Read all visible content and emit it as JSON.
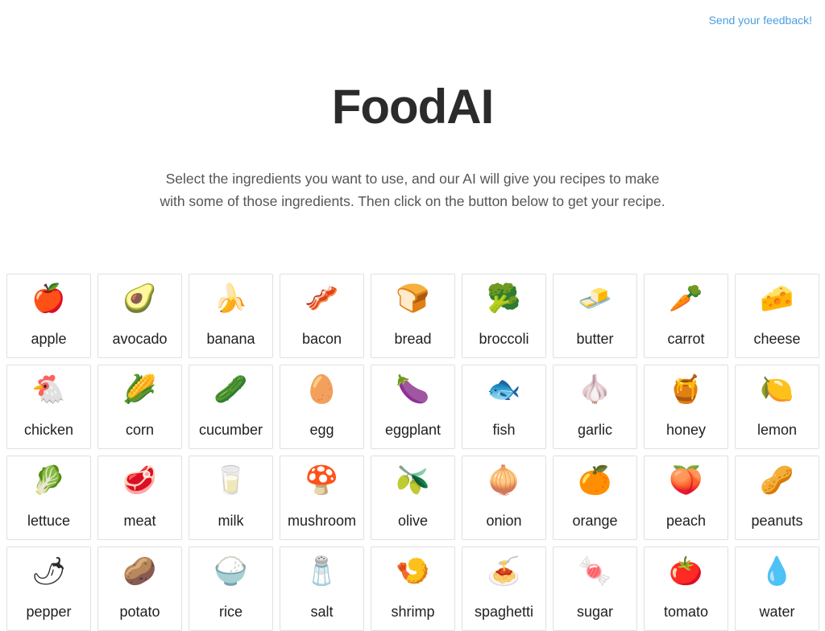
{
  "header": {
    "feedback_link": "Send your feedback!"
  },
  "main": {
    "title": "FoodAI",
    "intro": "Select the ingredients you want to use, and our AI will give you recipes to make with some of those ingredients. Then click on the button below to get your recipe."
  },
  "ingredients": [
    {
      "label": "apple",
      "icon": "🍎",
      "icon_name": "apple-icon"
    },
    {
      "label": "avocado",
      "icon": "🥑",
      "icon_name": "avocado-icon"
    },
    {
      "label": "banana",
      "icon": "🍌",
      "icon_name": "banana-icon"
    },
    {
      "label": "bacon",
      "icon": "🥓",
      "icon_name": "bacon-icon"
    },
    {
      "label": "bread",
      "icon": "🍞",
      "icon_name": "bread-icon"
    },
    {
      "label": "broccoli",
      "icon": "🥦",
      "icon_name": "broccoli-icon"
    },
    {
      "label": "butter",
      "icon": "🧈",
      "icon_name": "butter-icon"
    },
    {
      "label": "carrot",
      "icon": "🥕",
      "icon_name": "carrot-icon"
    },
    {
      "label": "cheese",
      "icon": "🧀",
      "icon_name": "cheese-icon"
    },
    {
      "label": "chicken",
      "icon": "🐔",
      "icon_name": "chicken-icon"
    },
    {
      "label": "corn",
      "icon": "🌽",
      "icon_name": "corn-icon"
    },
    {
      "label": "cucumber",
      "icon": "🥒",
      "icon_name": "cucumber-icon"
    },
    {
      "label": "egg",
      "icon": "🥚",
      "icon_name": "egg-icon"
    },
    {
      "label": "eggplant",
      "icon": "🍆",
      "icon_name": "eggplant-icon"
    },
    {
      "label": "fish",
      "icon": "🐟",
      "icon_name": "fish-icon"
    },
    {
      "label": "garlic",
      "icon": "🧄",
      "icon_name": "garlic-icon"
    },
    {
      "label": "honey",
      "icon": "🍯",
      "icon_name": "honey-icon"
    },
    {
      "label": "lemon",
      "icon": "🍋",
      "icon_name": "lemon-icon"
    },
    {
      "label": "lettuce",
      "icon": "🥬",
      "icon_name": "lettuce-icon"
    },
    {
      "label": "meat",
      "icon": "🥩",
      "icon_name": "meat-icon"
    },
    {
      "label": "milk",
      "icon": "🥛",
      "icon_name": "milk-icon"
    },
    {
      "label": "mushroom",
      "icon": "🍄",
      "icon_name": "mushroom-icon"
    },
    {
      "label": "olive",
      "icon": "🫒",
      "icon_name": "olive-icon"
    },
    {
      "label": "onion",
      "icon": "🧅",
      "icon_name": "onion-icon"
    },
    {
      "label": "orange",
      "icon": "🍊",
      "icon_name": "orange-icon"
    },
    {
      "label": "peach",
      "icon": "🍑",
      "icon_name": "peach-icon"
    },
    {
      "label": "peanuts",
      "icon": "🥜",
      "icon_name": "peanuts-icon"
    },
    {
      "label": "pepper",
      "icon": "🌶",
      "icon_name": "pepper-icon"
    },
    {
      "label": "potato",
      "icon": "🥔",
      "icon_name": "potato-icon"
    },
    {
      "label": "rice",
      "icon": "🍚",
      "icon_name": "rice-icon"
    },
    {
      "label": "salt",
      "icon": "🧂",
      "icon_name": "salt-icon"
    },
    {
      "label": "shrimp",
      "icon": "🍤",
      "icon_name": "shrimp-icon"
    },
    {
      "label": "spaghetti",
      "icon": "🍝",
      "icon_name": "spaghetti-icon"
    },
    {
      "label": "sugar",
      "icon": "🍬",
      "icon_name": "sugar-icon"
    },
    {
      "label": "tomato",
      "icon": "🍅",
      "icon_name": "tomato-icon"
    },
    {
      "label": "water",
      "icon": "💧",
      "icon_name": "water-icon"
    }
  ]
}
